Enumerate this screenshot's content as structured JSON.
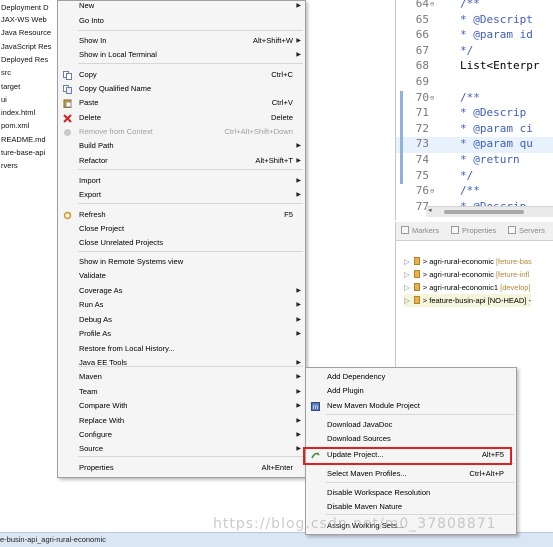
{
  "explorer": {
    "items": [
      "Deployment D",
      "JAX-WS Web",
      "Java Resource",
      "JavaScript Res",
      "Deployed Res",
      "src",
      "target",
      "ui",
      "index.html",
      "pom.xml",
      "README.md",
      "ture-base-api",
      "rvers"
    ]
  },
  "editor": {
    "lines": [
      {
        "num": "64",
        "fold": "⊖",
        "code": "/**"
      },
      {
        "num": "65",
        "fold": "",
        "code": " * @Descript"
      },
      {
        "num": "66",
        "fold": "",
        "code": " * @param id"
      },
      {
        "num": "67",
        "fold": "",
        "code": " */"
      },
      {
        "num": "68",
        "fold": "",
        "code": "List<Enterpr"
      },
      {
        "num": "69",
        "fold": "",
        "code": ""
      },
      {
        "num": "70",
        "fold": "⊖",
        "code": "/**"
      },
      {
        "num": "71",
        "fold": "",
        "code": " * @Descrip"
      },
      {
        "num": "72",
        "fold": "",
        "code": " * @param ci"
      },
      {
        "num": "73",
        "fold": "",
        "code": " * @param qu"
      },
      {
        "num": "74",
        "fold": "",
        "code": " * @return"
      },
      {
        "num": "75",
        "fold": "",
        "code": " */"
      },
      {
        "num": "76",
        "fold": "⊖",
        "code": "/**"
      },
      {
        "num": "77",
        "fold": "",
        "code": " * @Descrip"
      }
    ]
  },
  "views": {
    "tabs": [
      "Markers",
      "Properties",
      "Servers"
    ],
    "repos": [
      {
        "name": "agri-rural-economic",
        "branch": "[feture-bas"
      },
      {
        "name": "agri-rural-economic",
        "branch": "[feture-infl"
      },
      {
        "name": "agri-rural-economic1",
        "branch": "[develop]"
      },
      {
        "name": "feature-busin-api",
        "branch": "[NO-HEAD] -"
      }
    ]
  },
  "status_bar": {
    "text": "e-busin-api_agri-rural-economic"
  },
  "context_menu": {
    "items": [
      {
        "label": "New",
        "shortcut": "",
        "submenu": true,
        "disabled": false,
        "icon": ""
      },
      {
        "label": "Go Into",
        "shortcut": "",
        "submenu": false,
        "disabled": false,
        "icon": ""
      },
      {
        "label": "Show In",
        "shortcut": "Alt+Shift+W",
        "submenu": true,
        "disabled": false,
        "icon": ""
      },
      {
        "label": "Show in Local Terminal",
        "shortcut": "",
        "submenu": true,
        "disabled": false,
        "icon": ""
      },
      {
        "label": "Copy",
        "shortcut": "Ctrl+C",
        "submenu": false,
        "disabled": false,
        "icon": "copy-icon"
      },
      {
        "label": "Copy Qualified Name",
        "shortcut": "",
        "submenu": false,
        "disabled": false,
        "icon": "copy-qualified-icon"
      },
      {
        "label": "Paste",
        "shortcut": "Ctrl+V",
        "submenu": false,
        "disabled": false,
        "icon": "paste-icon"
      },
      {
        "label": "Delete",
        "shortcut": "Delete",
        "submenu": false,
        "disabled": false,
        "icon": "delete-icon"
      },
      {
        "label": "Remove from Context",
        "shortcut": "Ctrl+Alt+Shift+Down",
        "submenu": false,
        "disabled": true,
        "icon": "remove-context-icon"
      },
      {
        "label": "Build Path",
        "shortcut": "",
        "submenu": true,
        "disabled": false,
        "icon": ""
      },
      {
        "label": "Refactor",
        "shortcut": "Alt+Shift+T",
        "submenu": true,
        "disabled": false,
        "icon": ""
      },
      {
        "label": "Import",
        "shortcut": "",
        "submenu": true,
        "disabled": false,
        "icon": "import-icon"
      },
      {
        "label": "Export",
        "shortcut": "",
        "submenu": true,
        "disabled": false,
        "icon": "export-icon"
      },
      {
        "label": "Refresh",
        "shortcut": "F5",
        "submenu": false,
        "disabled": false,
        "icon": "refresh-icon"
      },
      {
        "label": "Close Project",
        "shortcut": "",
        "submenu": false,
        "disabled": false,
        "icon": ""
      },
      {
        "label": "Close Unrelated Projects",
        "shortcut": "",
        "submenu": false,
        "disabled": false,
        "icon": ""
      },
      {
        "label": "Show in Remote Systems view",
        "shortcut": "",
        "submenu": false,
        "disabled": false,
        "icon": ""
      },
      {
        "label": "Validate",
        "shortcut": "",
        "submenu": false,
        "disabled": false,
        "icon": ""
      },
      {
        "label": "Coverage As",
        "shortcut": "",
        "submenu": true,
        "disabled": false,
        "icon": ""
      },
      {
        "label": "Run As",
        "shortcut": "",
        "submenu": true,
        "disabled": false,
        "icon": ""
      },
      {
        "label": "Debug As",
        "shortcut": "",
        "submenu": true,
        "disabled": false,
        "icon": ""
      },
      {
        "label": "Profile As",
        "shortcut": "",
        "submenu": true,
        "disabled": false,
        "icon": ""
      },
      {
        "label": "Restore from Local History...",
        "shortcut": "",
        "submenu": false,
        "disabled": false,
        "icon": ""
      },
      {
        "label": "Java EE Tools",
        "shortcut": "",
        "submenu": true,
        "disabled": false,
        "icon": ""
      },
      {
        "label": "Maven",
        "shortcut": "",
        "submenu": true,
        "disabled": false,
        "icon": ""
      },
      {
        "label": "Team",
        "shortcut": "",
        "submenu": true,
        "disabled": false,
        "icon": ""
      },
      {
        "label": "Compare With",
        "shortcut": "",
        "submenu": true,
        "disabled": false,
        "icon": ""
      },
      {
        "label": "Replace With",
        "shortcut": "",
        "submenu": true,
        "disabled": false,
        "icon": ""
      },
      {
        "label": "Configure",
        "shortcut": "",
        "submenu": true,
        "disabled": false,
        "icon": ""
      },
      {
        "label": "Source",
        "shortcut": "",
        "submenu": true,
        "disabled": false,
        "icon": ""
      },
      {
        "label": "Properties",
        "shortcut": "Alt+Enter",
        "submenu": false,
        "disabled": false,
        "icon": ""
      }
    ]
  },
  "maven_submenu": {
    "items": [
      {
        "label": "Add Dependency",
        "shortcut": "",
        "icon": ""
      },
      {
        "label": "Add Plugin",
        "shortcut": "",
        "icon": ""
      },
      {
        "label": "New Maven Module Project",
        "shortcut": "",
        "icon": "maven-module-icon"
      },
      {
        "label": "Download JavaDoc",
        "shortcut": "",
        "icon": ""
      },
      {
        "label": "Download Sources",
        "shortcut": "",
        "icon": ""
      },
      {
        "label": "Update Project...",
        "shortcut": "Alt+F5",
        "icon": "update-project-icon"
      },
      {
        "label": "Select Maven Profiles...",
        "shortcut": "Ctrl+Alt+P",
        "icon": ""
      },
      {
        "label": "Disable Workspace Resolution",
        "shortcut": "",
        "icon": ""
      },
      {
        "label": "Disable Maven Nature",
        "shortcut": "",
        "icon": ""
      },
      {
        "label": "Assign Working Sets...",
        "shortcut": "",
        "icon": ""
      }
    ]
  },
  "watermark": "https://blog.csdn.net/m0_37808871",
  "colors": {
    "highlight_border": "#e02020",
    "menu_bg": "#f5f5f5",
    "status_bg": "#dbe6f4"
  }
}
